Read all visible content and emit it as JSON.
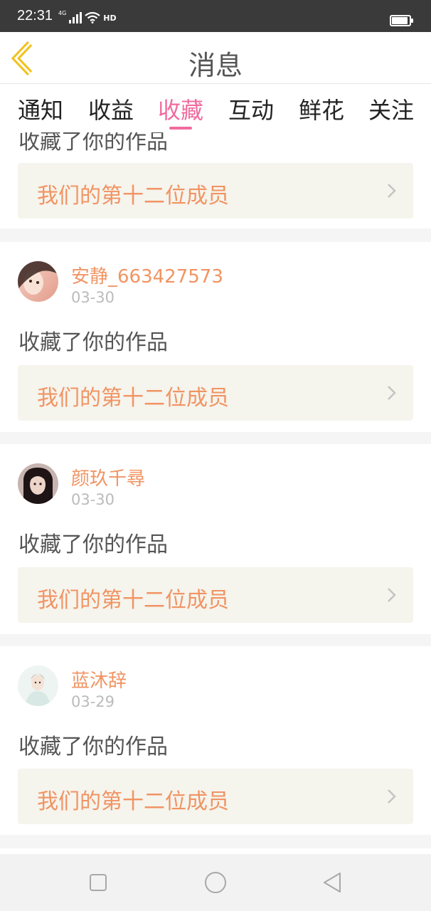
{
  "status_bar": {
    "time": "22:31",
    "network": "4G",
    "hd": "HD",
    "battery_level": 0.85
  },
  "header": {
    "title": "消息"
  },
  "tabs": [
    {
      "label": "通知",
      "active": false
    },
    {
      "label": "收益",
      "active": false
    },
    {
      "label": "收藏",
      "active": true
    },
    {
      "label": "互动",
      "active": false
    },
    {
      "label": "鲜花",
      "active": false
    },
    {
      "label": "关注",
      "active": false
    }
  ],
  "partial_card": {
    "action": "收藏了你的作品",
    "work_title": "我们的第十二位成员"
  },
  "messages": [
    {
      "username": "安静_663427573",
      "date": "03-30",
      "action": "收藏了你的作品",
      "work_title": "我们的第十二位成员"
    },
    {
      "username": "颜玖千尋",
      "date": "03-30",
      "action": "收藏了你的作品",
      "work_title": "我们的第十二位成员"
    },
    {
      "username": "蓝沐辞",
      "date": "03-29",
      "action": "收藏了你的作品",
      "work_title": "我们的第十二位成员"
    }
  ],
  "colors": {
    "accent_pink": "#f06c9f",
    "orange_text": "#f19463",
    "back_arrow": "#f2c11c",
    "work_box_bg": "#f5f4ed"
  },
  "icons": [
    "back-arrow-icon",
    "chevron-right-icon",
    "signal-icon",
    "wifi-icon",
    "battery-icon",
    "square-nav-icon",
    "circle-nav-icon",
    "triangle-back-nav-icon"
  ]
}
